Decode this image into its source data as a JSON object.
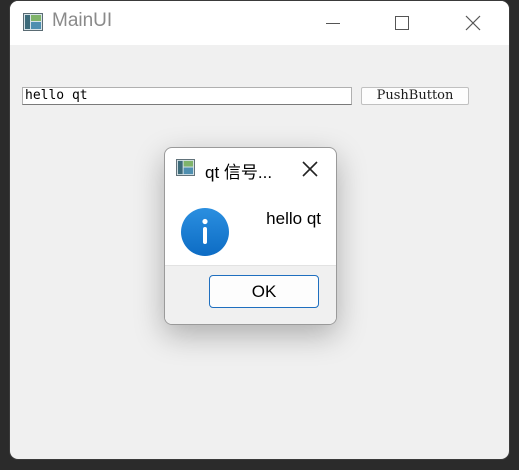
{
  "window": {
    "title": "MainUI",
    "icon": "qt-app-icon",
    "controls": [
      "minimize-icon",
      "maximize-icon",
      "close-icon"
    ]
  },
  "main": {
    "line_edit_value": "hello qt",
    "push_button_label": "PushButton"
  },
  "dialog": {
    "title": "qt 信号...",
    "icon": "information-icon",
    "message": "hello qt",
    "ok_label": "OK"
  },
  "colors": {
    "accent": "#1f6fbf",
    "info_icon": "#1a7fd6"
  }
}
